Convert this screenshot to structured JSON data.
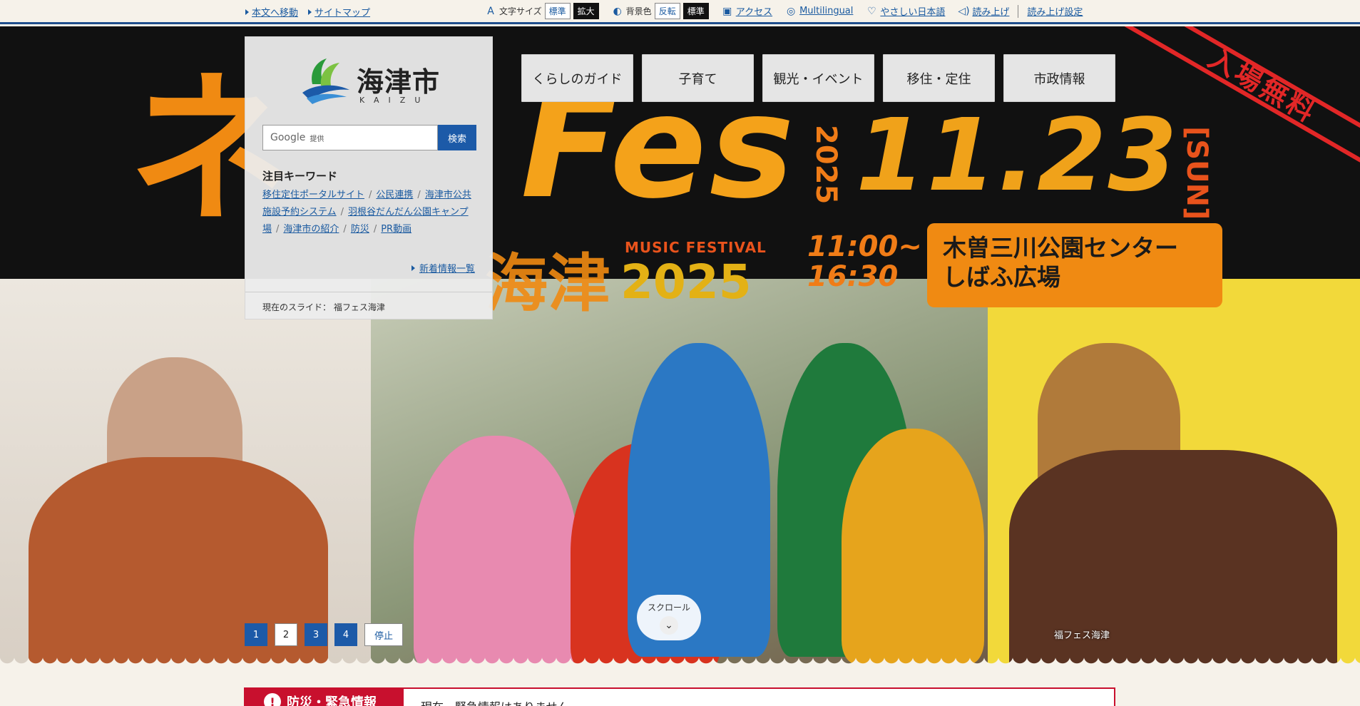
{
  "utility": {
    "skip_to_content": "本文へ移動",
    "sitemap": "サイトマップ",
    "font_size_label": "文字サイズ",
    "font_standard": "標準",
    "font_large": "拡大",
    "bg_color_label": "背景色",
    "bg_invert": "反転",
    "bg_standard": "標準",
    "access": "アクセス",
    "multilingual": "Multilingual",
    "easy_japanese": "やさしい日本語",
    "read_aloud": "読み上げ",
    "read_aloud_settings": "読み上げ設定"
  },
  "nav": {
    "tabs": [
      "くらしのガイド",
      "子育て",
      "観光・イベント",
      "移住・定住",
      "市政情報"
    ]
  },
  "logo": {
    "name": "海津市",
    "name_en": "KAIZU"
  },
  "search": {
    "placeholder_brand": "Google",
    "placeholder_provided": "提供",
    "button": "検索"
  },
  "keywords": {
    "title": "注目キーワード",
    "items": [
      "移住定住ポータルサイト",
      "公民連携",
      "海津市公共施設予約システム",
      "羽根谷だんだん公園キャンプ場",
      "海津市の紹介",
      "防災",
      "PR動画"
    ],
    "news_link": "新着情報一覧"
  },
  "slideshow": {
    "current_label": "現在のスライド：",
    "current_title": "福フェス海津",
    "pages": [
      "1",
      "2",
      "3",
      "4"
    ],
    "stop": "停止",
    "active_page": 2,
    "scroll": "スクロール",
    "caption": "福フェス海津"
  },
  "banner": {
    "fes": "Fes",
    "ne": "ネ",
    "city": "海津",
    "music": "MUSIC FESTIVAL",
    "year": "2025",
    "year_vertical": "2025",
    "date": "11.23",
    "day": "[SUN]",
    "time_start": "11:00~",
    "time_end": "16:30",
    "venue_line1": "木曽三川公園センター",
    "venue_line2": "しばふ広場",
    "free_admission": "入場無料"
  },
  "alert": {
    "label": "防災・緊急情報",
    "text": "現在、緊急情報はありません"
  },
  "colors": {
    "primary_blue": "#1c5aa8",
    "accent_orange": "#f08a12",
    "alert_red": "#c8102e",
    "page_bg": "#f6f2ea"
  }
}
